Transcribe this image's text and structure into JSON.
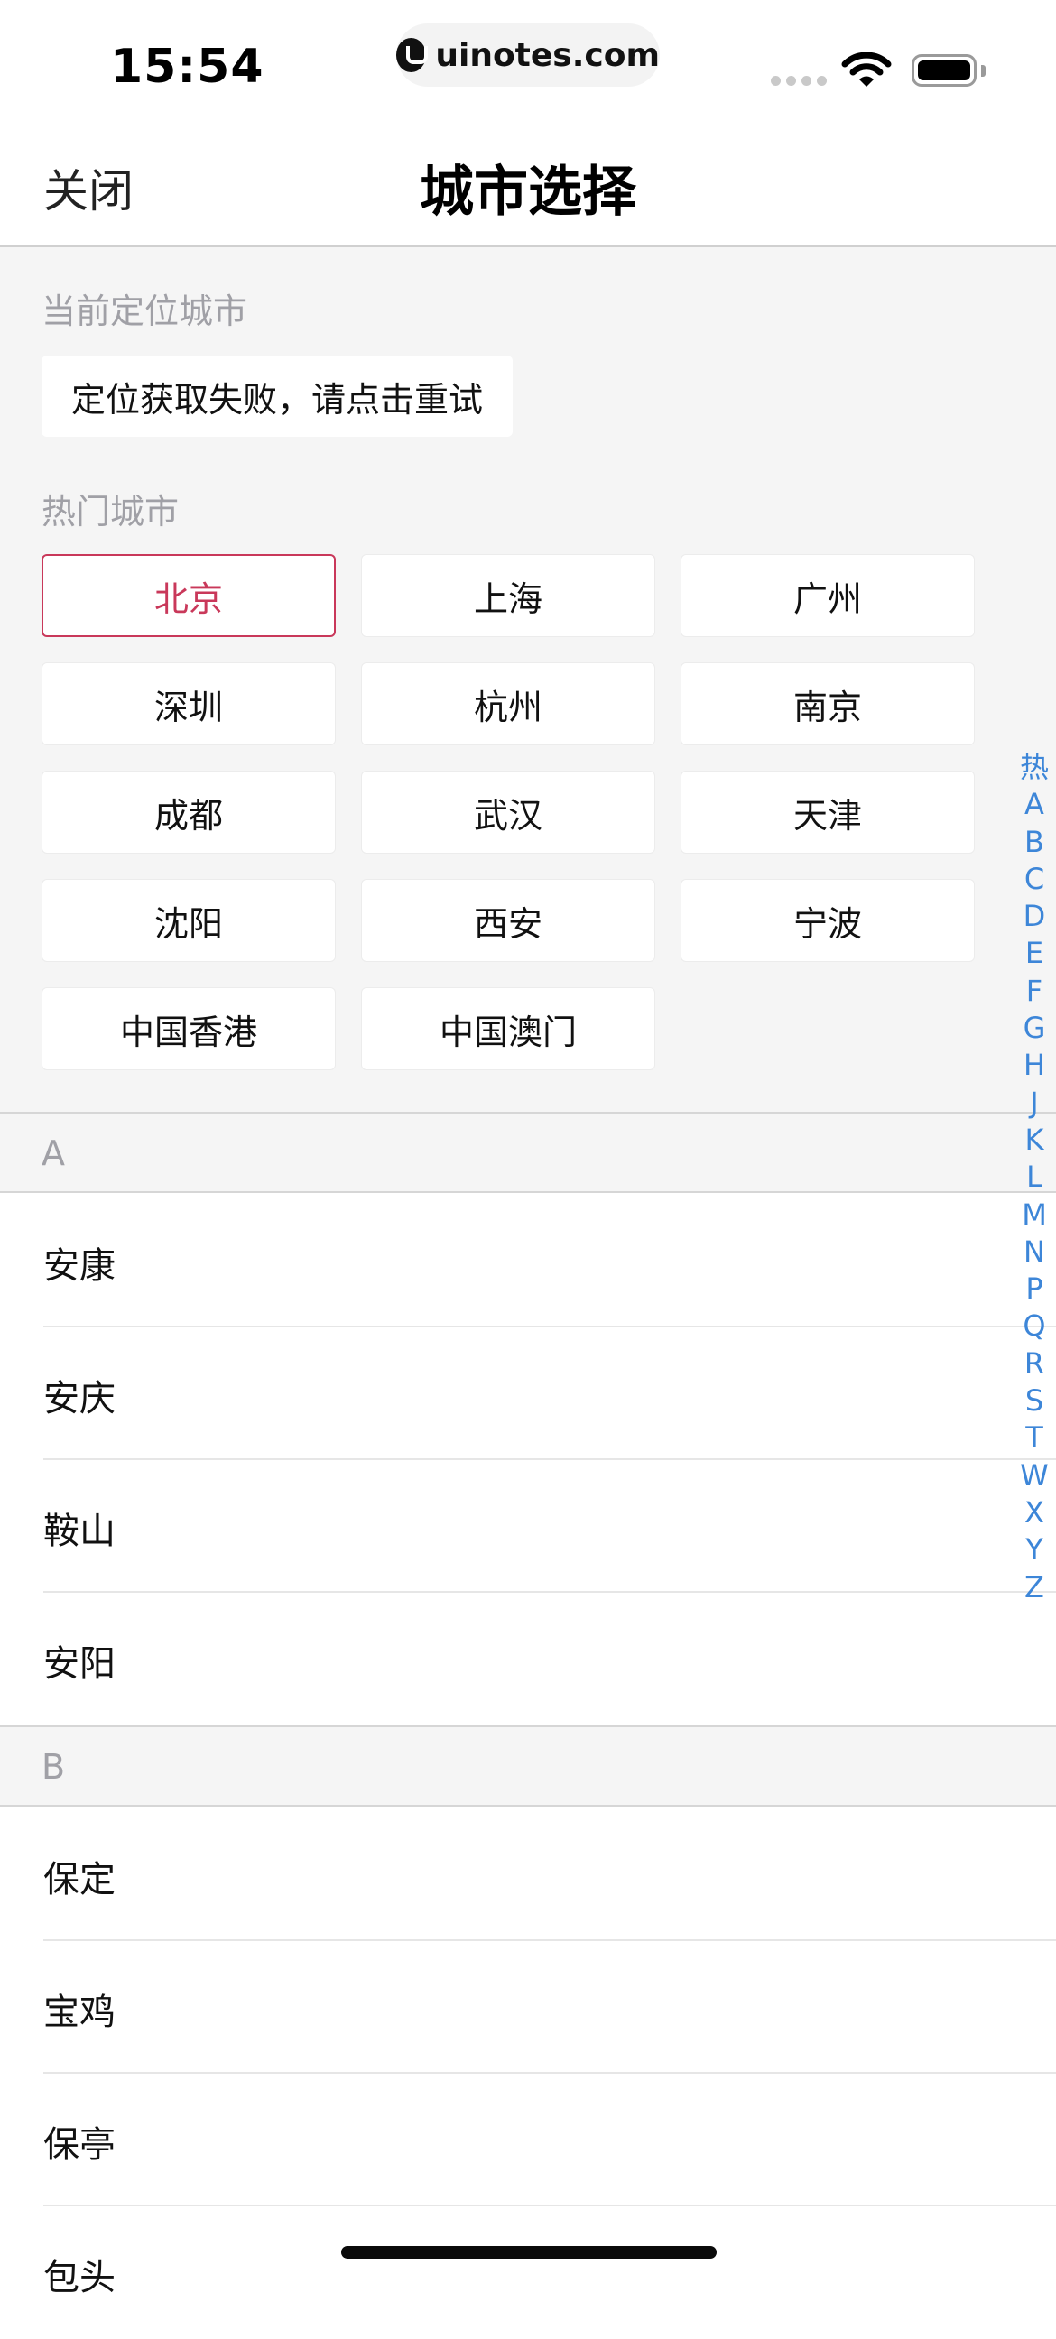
{
  "status_bar": {
    "time": "15:54",
    "url": "uinotes.com"
  },
  "nav": {
    "close_label": "关闭",
    "title": "城市选择"
  },
  "current_location": {
    "label": "当前定位城市",
    "button": "定位获取失败，请点击重试"
  },
  "hot_cities": {
    "label": "热门城市",
    "items": [
      "北京",
      "上海",
      "广州",
      "深圳",
      "杭州",
      "南京",
      "成都",
      "武汉",
      "天津",
      "沈阳",
      "西安",
      "宁波",
      "中国香港",
      "中国澳门"
    ],
    "selected": "北京"
  },
  "sections": [
    {
      "letter": "A",
      "cities": [
        "安康",
        "安庆",
        "鞍山",
        "安阳"
      ]
    },
    {
      "letter": "B",
      "cities": [
        "保定",
        "宝鸡",
        "保亭",
        "包头"
      ]
    }
  ],
  "index_bar": [
    "热",
    "A",
    "B",
    "C",
    "D",
    "E",
    "F",
    "G",
    "H",
    "J",
    "K",
    "L",
    "M",
    "N",
    "P",
    "Q",
    "R",
    "S",
    "T",
    "W",
    "X",
    "Y",
    "Z"
  ],
  "colors": {
    "accent_selected": "#c9385a",
    "index_blue": "#3d86d8",
    "muted_gray": "#a0a0a6",
    "panel_gray": "#f5f5f5"
  }
}
